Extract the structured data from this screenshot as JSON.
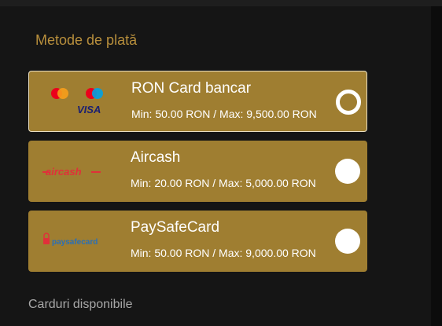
{
  "section_title": "Metode de plată",
  "methods": [
    {
      "name": "RON Card bancar",
      "limits": "Min: 50.00 RON / Max: 9,500.00 RON",
      "logo": "visa-mastercard-maestro-logo",
      "logo_text": "VISA",
      "selected": true
    },
    {
      "name": "Aircash",
      "limits": "Min: 20.00 RON / Max: 5,000.00 RON",
      "logo": "aircash-logo",
      "logo_text": "aircash",
      "selected": false
    },
    {
      "name": "PaySafeCard",
      "limits": "Min: 50.00 RON / Max: 9,000.00 RON",
      "logo": "paysafecard-logo",
      "logo_text": "paysafecard",
      "selected": false
    }
  ],
  "available_cards_title": "Carduri disponibile",
  "colors": {
    "background": "#151515",
    "card": "#9f7e31",
    "title": "#b88f3c"
  }
}
